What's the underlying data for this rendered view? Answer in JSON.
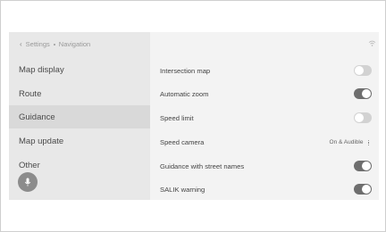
{
  "breadcrumb": {
    "parent": "Settings",
    "current": "Navigation"
  },
  "sidebar": {
    "items": [
      {
        "label": "Map display",
        "selected": false
      },
      {
        "label": "Route",
        "selected": false
      },
      {
        "label": "Guidance",
        "selected": true
      },
      {
        "label": "Map update",
        "selected": false
      },
      {
        "label": "Other",
        "selected": false
      }
    ]
  },
  "settings": [
    {
      "label": "Intersection map",
      "type": "toggle",
      "on": false
    },
    {
      "label": "Automatic zoom",
      "type": "toggle",
      "on": true
    },
    {
      "label": "Speed limit",
      "type": "toggle",
      "on": false
    },
    {
      "label": "Speed camera",
      "type": "value",
      "value": "On & Audible"
    },
    {
      "label": "Guidance with street names",
      "type": "toggle",
      "on": true
    },
    {
      "label": "SALIK warning",
      "type": "toggle",
      "on": true
    }
  ],
  "icons": {
    "back": "chevron-left-icon",
    "mic": "microphone-icon",
    "signal": "wifi-icon",
    "more": "more-vertical-icon"
  },
  "colors": {
    "toggle_on": "#6e6e6e",
    "toggle_off": "#d2d2d2",
    "selected_bg": "#d9d9d9"
  }
}
